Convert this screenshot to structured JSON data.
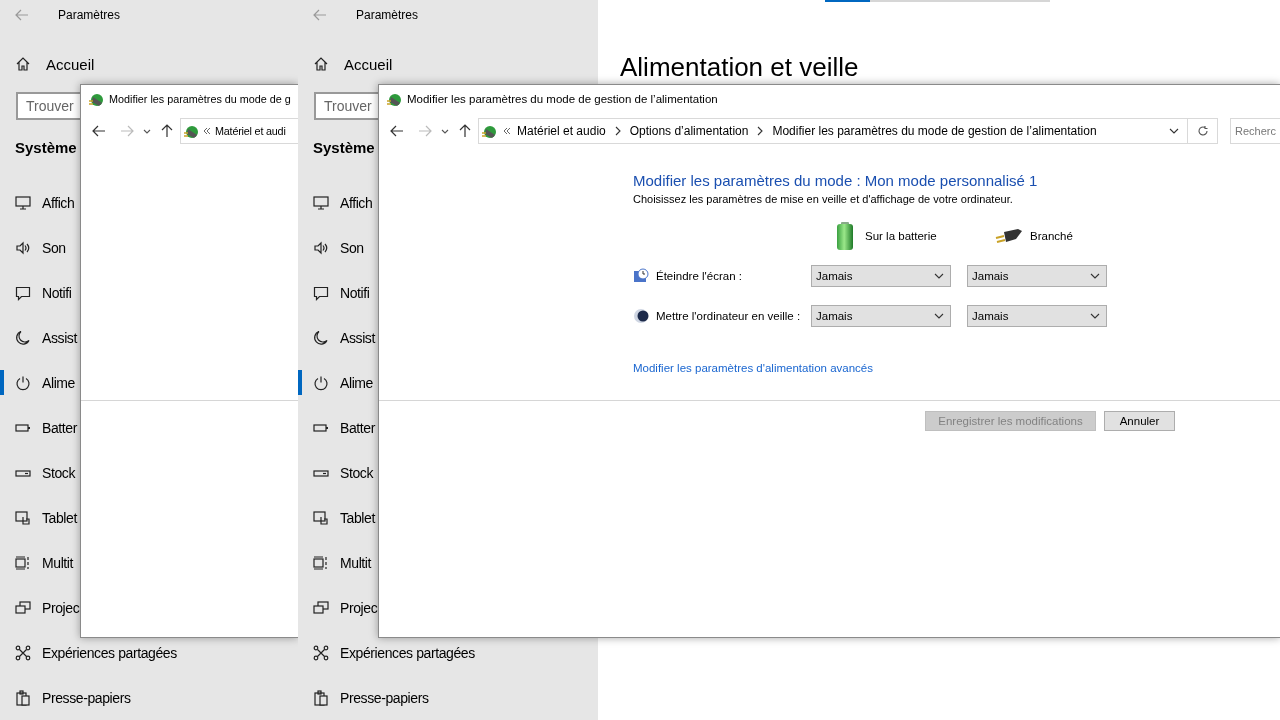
{
  "settings_windows": [
    {
      "title": "Paramètres",
      "home": "Accueil",
      "search": {
        "placeholder": "Trouver"
      },
      "section": "Système",
      "nav_items": [
        {
          "label": "Affich",
          "selected": false
        },
        {
          "label": "Son",
          "selected": false
        },
        {
          "label": "Notifi",
          "selected": false
        },
        {
          "label": "Assist",
          "selected": false
        },
        {
          "label": "Alime",
          "selected": true
        },
        {
          "label": "Batter",
          "selected": false
        },
        {
          "label": "Stock",
          "selected": false
        },
        {
          "label": "Tablet",
          "selected": false
        },
        {
          "label": "Multit",
          "selected": false
        },
        {
          "label": "Projec",
          "selected": false
        },
        {
          "label": "Expériences partagées",
          "selected": false
        },
        {
          "label": "Presse-papiers",
          "selected": false
        }
      ]
    },
    {
      "title": "Paramètres",
      "home": "Accueil",
      "search": {
        "placeholder": "Trouver"
      },
      "section": "Système",
      "nav_items": [
        {
          "label": "Affich",
          "selected": false
        },
        {
          "label": "Son",
          "selected": false
        },
        {
          "label": "Notifi",
          "selected": false
        },
        {
          "label": "Assist",
          "selected": false
        },
        {
          "label": "Alime",
          "selected": true
        },
        {
          "label": "Batter",
          "selected": false
        },
        {
          "label": "Stock",
          "selected": false
        },
        {
          "label": "Tablet",
          "selected": false
        },
        {
          "label": "Multit",
          "selected": false
        },
        {
          "label": "Projec",
          "selected": false
        },
        {
          "label": "Expériences partagées",
          "selected": false
        },
        {
          "label": "Presse-papiers",
          "selected": false
        }
      ]
    }
  ],
  "power_page": {
    "title": "Alimentation et veille"
  },
  "control_panel_windows": [
    {
      "title": "Modifier les paramètres du mode de g",
      "breadcrumb": [
        "Matériel et audi"
      ]
    },
    {
      "title": "Modifier les paramètres du mode de gestion de l’alimentation",
      "breadcrumb": [
        "Matériel et audio",
        "Options d’alimentation",
        "Modifier les paramètres du mode de gestion de l’alimentation"
      ],
      "search": {
        "placeholder": "Recherc"
      },
      "heading": "Modifier les paramètres du mode : Mon mode personnalisé 1",
      "subtitle": "Choisissez les paramètres de mise en veille et d'affichage de votre ordinateur.",
      "columns": [
        "Sur la batterie",
        "Branché"
      ],
      "settings": [
        {
          "label": "Éteindre l'écran :",
          "values": [
            "Jamais",
            "Jamais"
          ]
        },
        {
          "label": "Mettre l'ordinateur en veille :",
          "values": [
            "Jamais",
            "Jamais"
          ]
        }
      ],
      "advanced_link": "Modifier les paramètres d'alimentation avancés",
      "buttons": [
        {
          "label": "Enregistrer les modifications",
          "disabled": true
        },
        {
          "label": "Annuler",
          "disabled": false
        }
      ]
    }
  ]
}
